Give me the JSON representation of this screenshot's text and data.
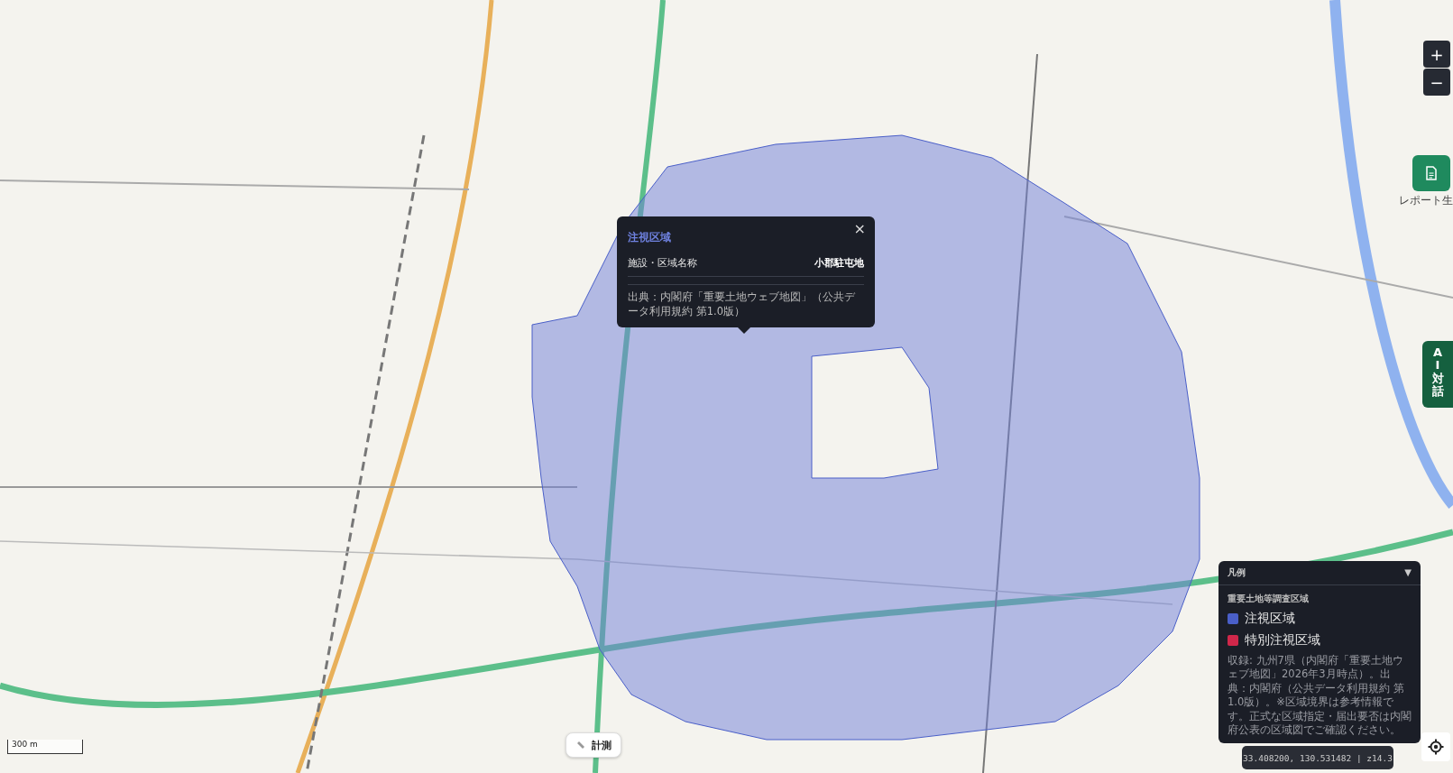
{
  "zoom": {
    "in": "+",
    "out": "−"
  },
  "report": {
    "label": "レポート生"
  },
  "ai_tab": {
    "label": "AI対話"
  },
  "popup": {
    "title": "注視区域",
    "close": "×",
    "rows": [
      {
        "label": "施設・区域名称",
        "value": "小郡駐屯地"
      }
    ],
    "source": "出典：内閣府「重要土地ウェブ地図」（公共データ利用規約 第1.0版）"
  },
  "legend": {
    "title": "凡例",
    "toggle": "▼",
    "section": "重要土地等調査区域",
    "items": [
      {
        "label": "注視区域",
        "color": "#4a5fc8"
      },
      {
        "label": "特別注視区域",
        "color": "#d0274a"
      }
    ],
    "note": "収録: 九州7県（内閣府「重要土地ウェブ地図」2026年3月時点）。出典：内閣府（公共データ利用規約 第1.0版）。※区域境界は参考情報です。正式な区域指定・届出要否は内閣府公表の区域図でご確認ください。"
  },
  "measure": {
    "label": "計測"
  },
  "scale": "300 m",
  "coordinates": "33.408200, 130.531482 | z14.3"
}
